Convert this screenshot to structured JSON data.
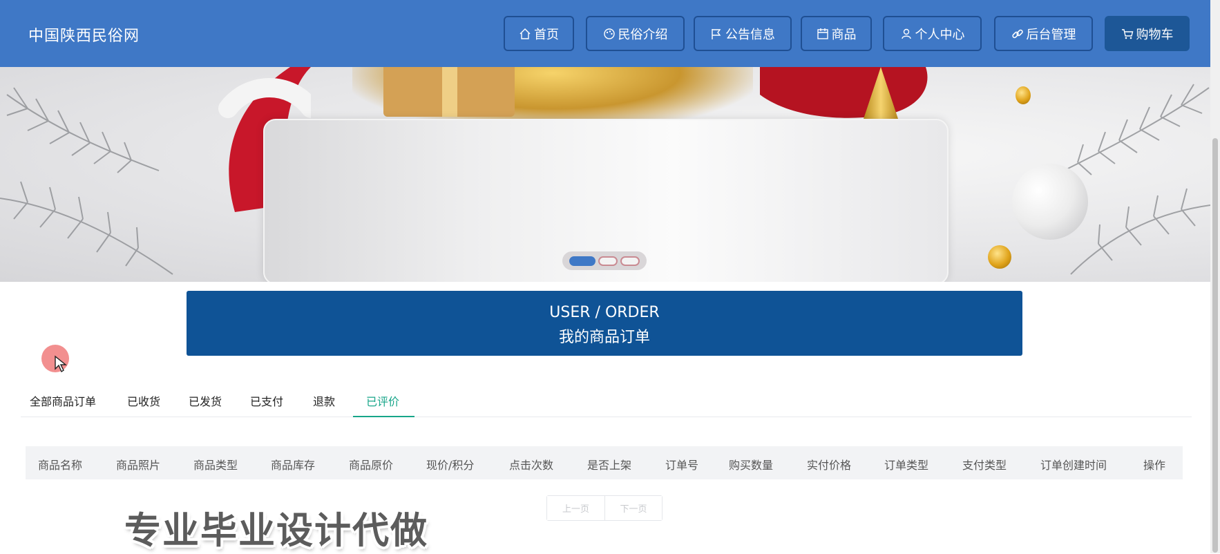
{
  "brand": "中国陕西民俗网",
  "nav": [
    {
      "label": "首页",
      "icon": "home-icon"
    },
    {
      "label": "民俗介绍",
      "icon": "palette-icon"
    },
    {
      "label": "公告信息",
      "icon": "flag-icon"
    },
    {
      "label": "商品",
      "icon": "calendar-icon"
    },
    {
      "label": "个人中心",
      "icon": "user-icon"
    },
    {
      "label": "后台管理",
      "icon": "link-icon"
    },
    {
      "label": "购物车",
      "icon": "cart-icon"
    }
  ],
  "carousel": {
    "slides": 3,
    "active_index": 0
  },
  "section": {
    "title_en": "USER / ORDER",
    "title_cn": "我的商品订单"
  },
  "tabs": {
    "items": [
      "全部商品订单",
      "已收货",
      "已发货",
      "已支付",
      "退款",
      "已评价"
    ],
    "active": "已评价"
  },
  "table": {
    "columns": [
      "商品名称",
      "商品照片",
      "商品类型",
      "商品库存",
      "商品原价",
      "现价/积分",
      "点击次数",
      "是否上架",
      "订单号",
      "购买数量",
      "实付价格",
      "订单类型",
      "支付类型",
      "订单创建时间",
      "操作"
    ]
  },
  "pager": {
    "prev": "上一页",
    "next": "下一页"
  },
  "watermark": "专业毕业设计代做",
  "colors": {
    "nav_bg": "#3f78c6",
    "cart_bg": "#1d5797",
    "title_bg": "#0f5396",
    "tab_active": "#17a589"
  }
}
